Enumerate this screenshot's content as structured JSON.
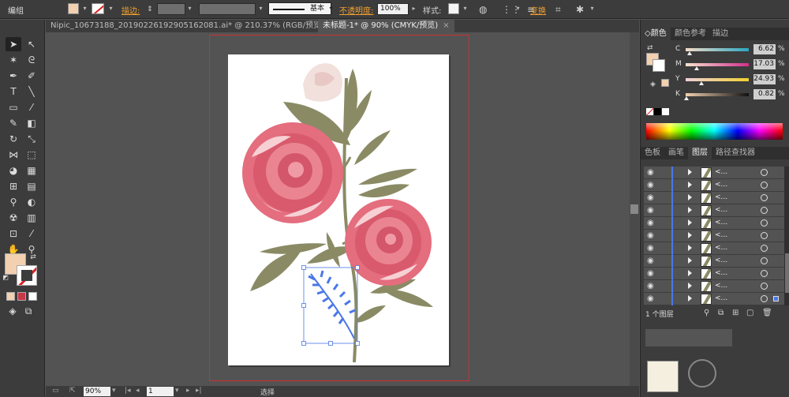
{
  "control_bar": {
    "selection_label": "编组",
    "stroke_label": "描边",
    "stroke_profile": "基本",
    "opacity_label": "不透明度",
    "opacity_value": "100%",
    "style_label": "样式",
    "transform_label": "变换"
  },
  "colors": {
    "fill": "#f2d0b0",
    "selection": "#4a78e8",
    "artboard_border": "#d03030",
    "leaf": "#8a8b65"
  },
  "tabs": [
    {
      "label": "Nipic_10673188_20190226192905162081.ai* @ 210.37% (RGB/预览)",
      "close": "×"
    },
    {
      "label": "未标题-1* @ 90% (CMYK/预览)",
      "close": "×"
    }
  ],
  "status": {
    "zoom": "90%",
    "page": "1",
    "mode": "选择"
  },
  "color_panel": {
    "tabs": [
      "颜色",
      "颜色参考",
      "描边"
    ],
    "sliders": [
      {
        "label": "C",
        "value": "6.62",
        "unit": "%",
        "level": 0.066
      },
      {
        "label": "M",
        "value": "17.03",
        "unit": "%",
        "level": 0.17
      },
      {
        "label": "Y",
        "value": "24.93",
        "unit": "%",
        "level": 0.249
      },
      {
        "label": "K",
        "value": "0.82",
        "unit": "%",
        "level": 0.008
      }
    ]
  },
  "layers_panel": {
    "tabs": [
      "色板",
      "画笔",
      "图层",
      "路径查找器"
    ],
    "row_name": "<...",
    "row_count": 11,
    "footer_label": "1 个图层"
  }
}
